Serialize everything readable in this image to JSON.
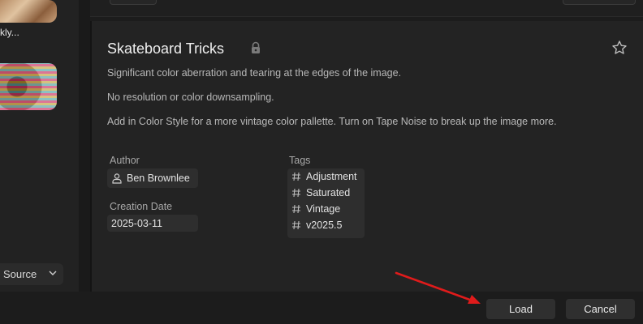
{
  "sidebar": {
    "thumb_label": "kly...",
    "source_label": "Source"
  },
  "preset": {
    "title": "Skateboard Tricks",
    "descriptions": [
      "Significant color aberration and tearing at the edges of the image.",
      "No resolution or color downsampling.",
      "Add in Color Style for a more vintage color pallette.  Turn on Tape Noise to break up the image more."
    ],
    "author_label": "Author",
    "author": "Ben Brownlee",
    "creation_date_label": "Creation Date",
    "creation_date": "2025-03-11",
    "tags_label": "Tags",
    "tags": [
      "Adjustment",
      "Saturated",
      "Vintage",
      "v2025.5"
    ]
  },
  "footer": {
    "load_label": "Load",
    "cancel_label": "Cancel"
  },
  "colors": {
    "annotation_arrow": "#e01b1b"
  }
}
